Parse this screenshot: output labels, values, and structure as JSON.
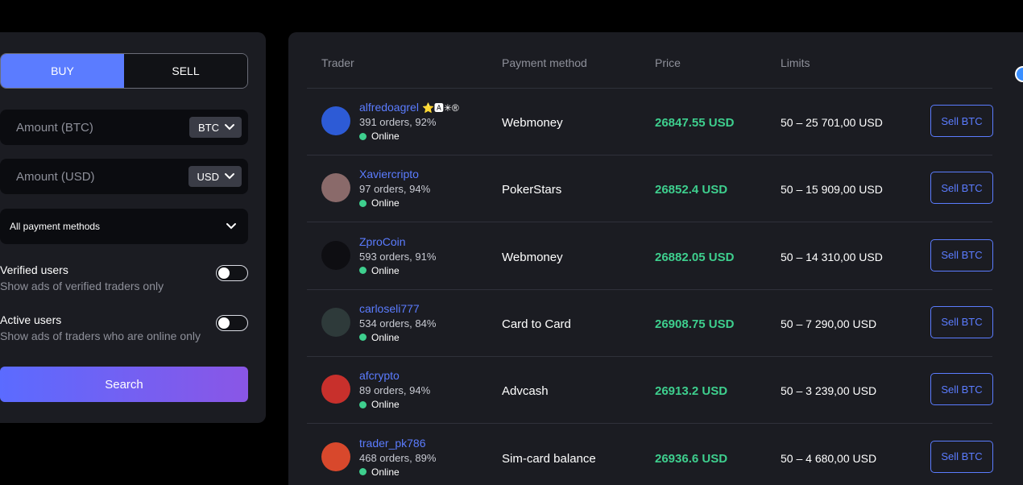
{
  "filters": {
    "tabs": [
      {
        "label": "BUY",
        "active": true
      },
      {
        "label": "SELL",
        "active": false
      }
    ],
    "amount_btc": {
      "placeholder": "Amount (BTC)",
      "currency": "BTC"
    },
    "amount_usd": {
      "placeholder": "Amount (USD)",
      "currency": "USD"
    },
    "payment_select": {
      "value": "All payment methods"
    },
    "verified": {
      "title": "Verified users",
      "desc": "Show ads of verified traders only",
      "on": false
    },
    "active": {
      "title": "Active users",
      "desc": "Show ads of traders who are online only",
      "on": false
    },
    "search_label": "Search"
  },
  "table": {
    "headers": {
      "trader": "Trader",
      "payment": "Payment method",
      "price": "Price",
      "limits": "Limits"
    },
    "rows": [
      {
        "name": "alfredoagrel",
        "badges": "⭐🅰✳®",
        "orders": "391 orders, 92%",
        "status": "Online",
        "payment": "Webmoney",
        "price": "26847.55 USD",
        "limits": "50 – 25 701,00 USD",
        "action": "Sell BTC",
        "avatar_color": "#2d5bd6"
      },
      {
        "name": "Xaviercripto",
        "badges": "",
        "orders": "97 orders, 94%",
        "status": "Online",
        "payment": "PokerStars",
        "price": "26852.4 USD",
        "limits": "50 – 15 909,00 USD",
        "action": "Sell BTC",
        "avatar_color": "#8a6a6a"
      },
      {
        "name": "ZproCoin",
        "badges": "",
        "orders": "593 orders, 91%",
        "status": "Online",
        "payment": "Webmoney",
        "price": "26882.05 USD",
        "limits": "50 – 14 310,00 USD",
        "action": "Sell BTC",
        "avatar_color": "#0e0e12"
      },
      {
        "name": "carloseli777",
        "badges": "",
        "orders": "534 orders, 84%",
        "status": "Online",
        "payment": "Card to Card",
        "price": "26908.75 USD",
        "limits": "50 – 7 290,00 USD",
        "action": "Sell BTC",
        "avatar_color": "#2e3a3a"
      },
      {
        "name": "afcrypto",
        "badges": "",
        "orders": "89 orders, 94%",
        "status": "Online",
        "payment": "Advcash",
        "price": "26913.2 USD",
        "limits": "50 – 3 239,00 USD",
        "action": "Sell BTC",
        "avatar_color": "#c8302c"
      },
      {
        "name": "trader_pk786",
        "badges": "",
        "orders": "468 orders, 89%",
        "status": "Online",
        "payment": "Sim-card balance",
        "price": "26936.6 USD",
        "limits": "50 – 4 680,00 USD",
        "action": "Sell BTC",
        "avatar_color": "#d8482c"
      }
    ]
  },
  "colors": {
    "accent": "#5b7cff",
    "price_green": "#3ecf8e",
    "panel": "#1b1c22"
  }
}
